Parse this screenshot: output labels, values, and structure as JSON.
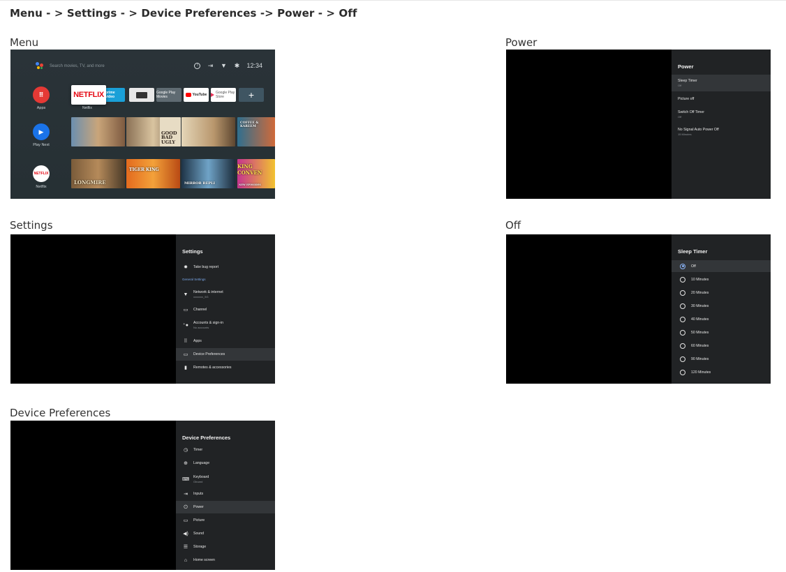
{
  "breadcrumb": "Menu - > Settings - > Device Preferences -> Power - > Off",
  "sections": {
    "menu": "Menu",
    "power": "Power",
    "settings": "Settings",
    "off": "Off",
    "device_preferences": "Device Preferences"
  },
  "home": {
    "search_placeholder": "Search movies, TV, and more",
    "time": "12:34",
    "sidebar": [
      {
        "label": "Apps"
      },
      {
        "label": "Play Next"
      },
      {
        "label": "Netflix",
        "badge": "NETFLIX"
      }
    ],
    "netflix_tile": "NETFLIX",
    "netflix_caption": "Netflix",
    "apps_row": [
      "prime video",
      "",
      "Google Play Movies",
      "YouTube",
      "Google Play Store"
    ],
    "posters_row1": [
      "",
      "",
      "GOOD BAD UGLY",
      "",
      "COFFEE & KAREEM"
    ],
    "posters_row2": [
      "LONGMIRE",
      "TIGER KING",
      "",
      "MIRROR REPLI",
      "KING CONVEN"
    ],
    "new_episodes": "NEW EPISODES",
    "colors": {
      "netflix_red": "#e50914",
      "play_blue": "#1a73e8"
    }
  },
  "power_screen": {
    "title": "Power",
    "items": [
      {
        "label": "Sleep Timer",
        "sub": "Off",
        "selected": true
      },
      {
        "label": "Picture off",
        "sub": ""
      },
      {
        "label": "Switch Off Timer",
        "sub": "Off"
      },
      {
        "label": "No Signal Auto Power Off",
        "sub": "15 Minutes"
      }
    ]
  },
  "settings_screen": {
    "title": "Settings",
    "bug_report": "Take bug report",
    "general_header": "General Settings",
    "items": [
      {
        "label": "Network & internet",
        "sub": "xxxxxxx_5G",
        "icon": "wifi-icon"
      },
      {
        "label": "Channel",
        "sub": "",
        "icon": "tv-icon"
      },
      {
        "label": "Accounts & sign-in",
        "sub": "No accounts",
        "icon": "account-add-icon"
      },
      {
        "label": "Apps",
        "sub": "",
        "icon": "apps-grid-icon"
      },
      {
        "label": "Device Preferences",
        "sub": "",
        "icon": "monitor-icon",
        "selected": true
      },
      {
        "label": "Remotes & accessories",
        "sub": "",
        "icon": "remote-icon"
      }
    ]
  },
  "sleep_timer_screen": {
    "title": "Sleep Timer",
    "options": [
      "Off",
      "10 Minutes",
      "20 Minutes",
      "30 Minutes",
      "40 Minutes",
      "50 Minutes",
      "60 Minutes",
      "90 Minutes",
      "120 Minutes"
    ],
    "selected_index": 0
  },
  "device_prefs_screen": {
    "title": "Device Preferences",
    "items": [
      {
        "label": "Timer",
        "sub": "",
        "icon": "clock-icon"
      },
      {
        "label": "Language",
        "sub": "",
        "icon": "globe-icon"
      },
      {
        "label": "Keyboard",
        "sub": "Gboard",
        "icon": "keyboard-icon"
      },
      {
        "label": "Inputs",
        "sub": "",
        "icon": "input-icon"
      },
      {
        "label": "Power",
        "sub": "",
        "icon": "power-plug-icon",
        "selected": true
      },
      {
        "label": "Picture",
        "sub": "",
        "icon": "monitor-icon"
      },
      {
        "label": "Sound",
        "sub": "",
        "icon": "speaker-icon"
      },
      {
        "label": "Storage",
        "sub": "",
        "icon": "storage-icon"
      },
      {
        "label": "Home screen",
        "sub": "",
        "icon": "home-icon"
      }
    ]
  }
}
